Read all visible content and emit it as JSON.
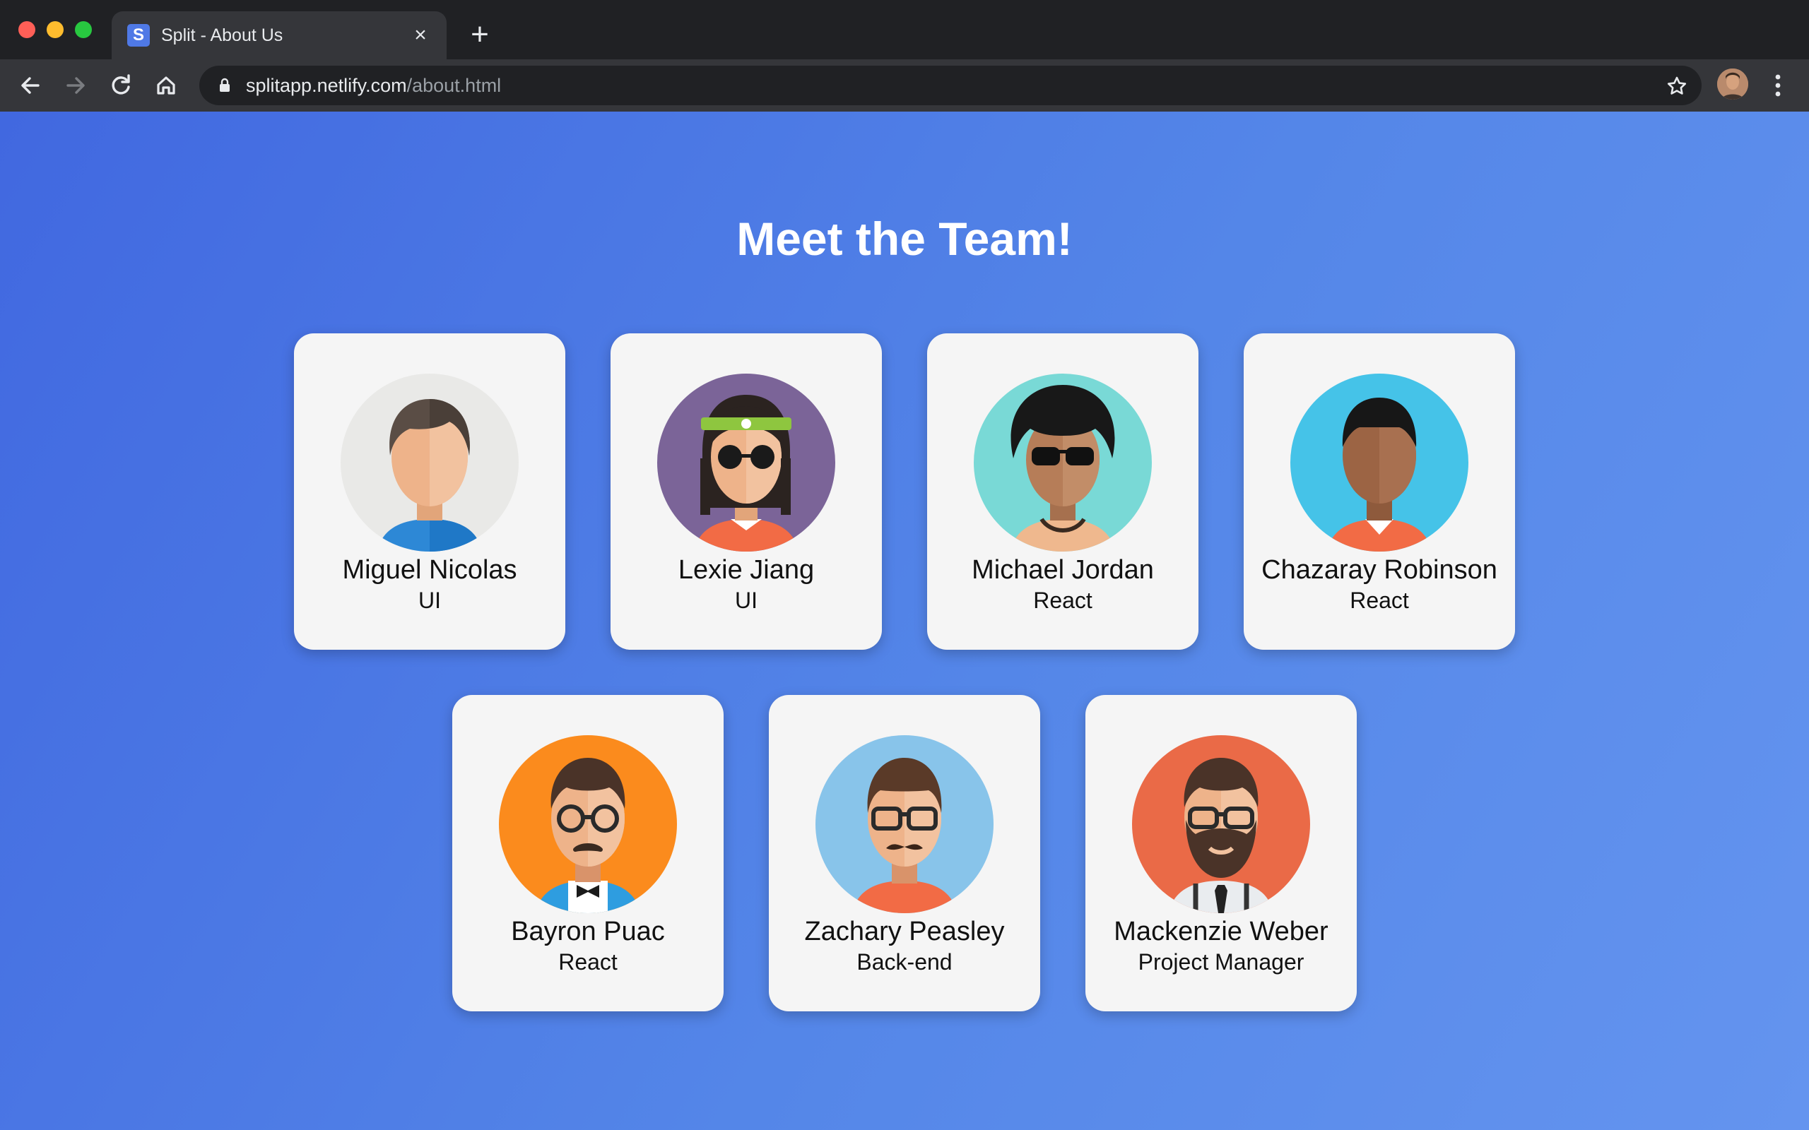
{
  "browser": {
    "tab_title": "Split - About Us",
    "favicon_letter": "S",
    "url_host": "splitapp.netlify.com",
    "url_path": "/about.html"
  },
  "page": {
    "heading": "Meet the Team!"
  },
  "team": [
    {
      "name": "Miguel Nicolas",
      "role": "UI",
      "avatar_bg": "#e9e9e7"
    },
    {
      "name": "Lexie Jiang",
      "role": "UI",
      "avatar_bg": "#7b6498"
    },
    {
      "name": "Michael Jordan",
      "role": "React",
      "avatar_bg": "#79d9d6"
    },
    {
      "name": "Chazaray Robinson",
      "role": "React",
      "avatar_bg": "#45c3e8"
    },
    {
      "name": "Bayron Puac",
      "role": "React",
      "avatar_bg": "#fb8b1d"
    },
    {
      "name": "Zachary Peasley",
      "role": "Back-end",
      "avatar_bg": "#88c4ea"
    },
    {
      "name": "Mackenzie Weber",
      "role": "Project Manager",
      "avatar_bg": "#ea6a47"
    }
  ]
}
